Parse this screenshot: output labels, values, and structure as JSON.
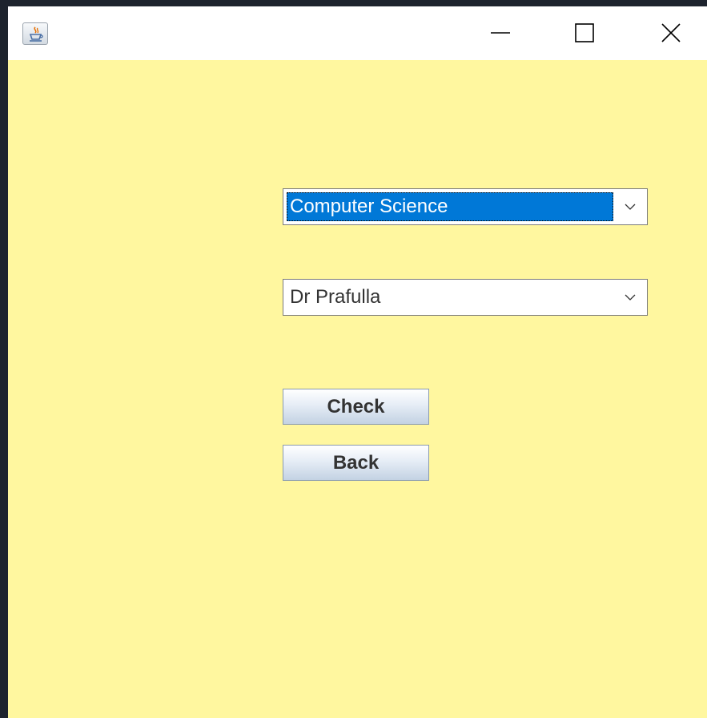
{
  "window": {
    "background": "#fff79f",
    "titlebar": {
      "icon": "java-cup-icon",
      "controls": [
        "minimize-icon",
        "maximize-icon",
        "close-icon"
      ]
    }
  },
  "form": {
    "department_select": {
      "value": "Computer Science",
      "selected_highlight": "#0078d7",
      "icon": "chevron-down-icon"
    },
    "faculty_select": {
      "value": "Dr Prafulla",
      "icon": "chevron-down-icon"
    },
    "check_button": {
      "label": "Check"
    },
    "back_button": {
      "label": "Back"
    }
  }
}
